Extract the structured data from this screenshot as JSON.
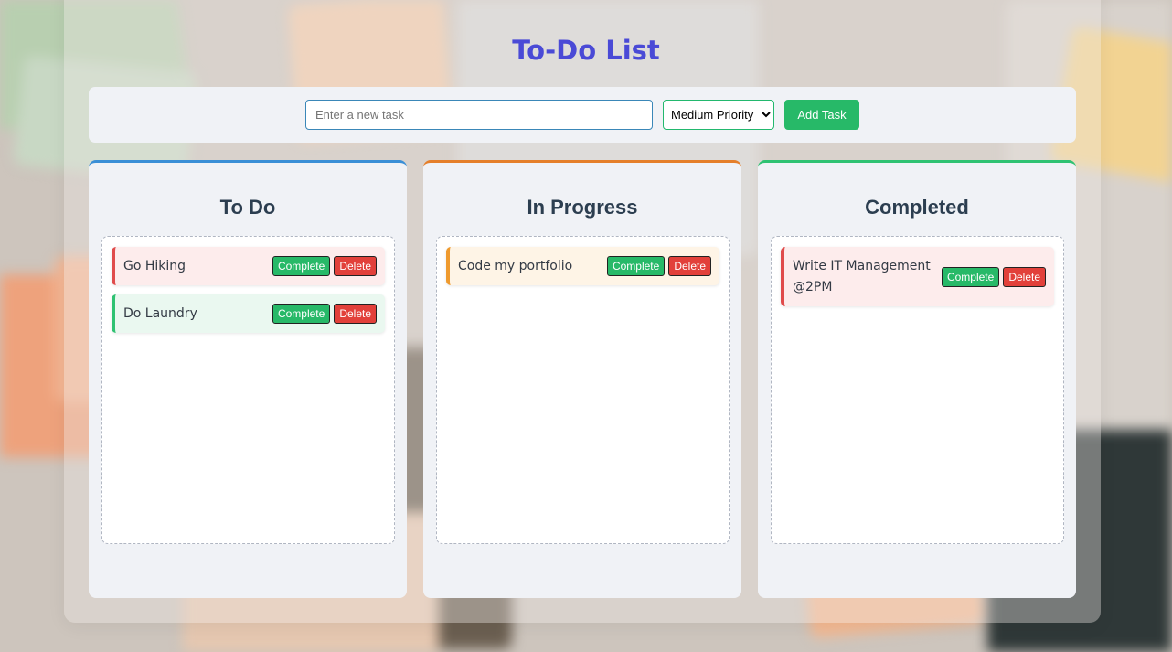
{
  "page": {
    "title": "To-Do List"
  },
  "add_bar": {
    "input_placeholder": "Enter a new task",
    "input_value": "",
    "priority_selected": "Medium Priority",
    "add_label": "Add Task"
  },
  "columns": [
    {
      "title": "To Do",
      "accent": "#3a8fd6",
      "tasks": [
        {
          "text": "Go Hiking",
          "complete_label": "Complete",
          "delete_label": "Delete"
        },
        {
          "text": "Do Laundry",
          "complete_label": "Complete",
          "delete_label": "Delete"
        }
      ]
    },
    {
      "title": "In Progress",
      "accent": "#e57f2a",
      "tasks": [
        {
          "text": "Code my portfolio",
          "complete_label": "Complete",
          "delete_label": "Delete"
        }
      ]
    },
    {
      "title": "Completed",
      "accent": "#2fc272",
      "tasks": [
        {
          "text": "Write IT Management @2PM",
          "complete_label": "Complete",
          "delete_label": "Delete"
        }
      ]
    }
  ],
  "colors": {
    "title": "#4a4ad6",
    "complete_button": "#27b968",
    "delete_button": "#e2403a",
    "priority_high": "#e04b4b",
    "priority_medium": "#ef9a2e",
    "priority_low": "#2fc272"
  }
}
